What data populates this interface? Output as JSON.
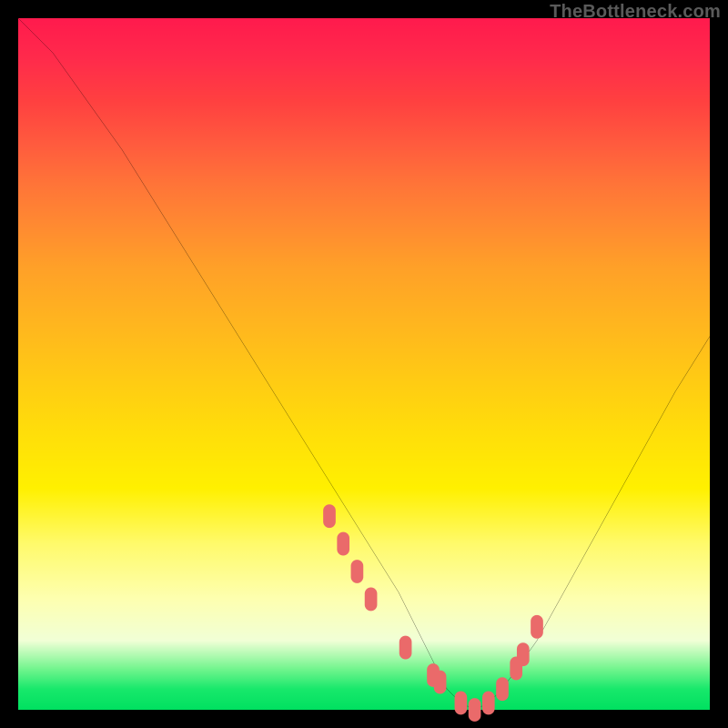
{
  "watermark": "TheBottleneck.com",
  "chart_data": {
    "type": "line",
    "title": "",
    "xlabel": "",
    "ylabel": "",
    "xlim": [
      0,
      100
    ],
    "ylim": [
      0,
      100
    ],
    "series": [
      {
        "name": "curve",
        "x": [
          0,
          5,
          10,
          15,
          20,
          25,
          30,
          35,
          40,
          45,
          50,
          55,
          58,
          60,
          62,
          64,
          66,
          68,
          70,
          75,
          80,
          85,
          90,
          95,
          100
        ],
        "y": [
          100,
          95,
          88,
          81,
          73,
          65,
          57,
          49,
          41,
          33,
          25,
          17,
          11,
          7,
          3,
          1,
          0,
          1,
          3,
          10,
          19,
          28,
          37,
          46,
          54
        ]
      }
    ],
    "markers": {
      "name": "bottleneck-dots",
      "color": "#ea6a6a",
      "x": [
        45,
        47,
        49,
        51,
        56,
        60,
        61,
        64,
        66,
        68,
        70,
        72,
        73,
        75
      ],
      "y": [
        28,
        24,
        20,
        16,
        9,
        5,
        4,
        1,
        0,
        1,
        3,
        6,
        8,
        12
      ]
    },
    "background_gradient": {
      "top": "#ff1a4d",
      "mid": "#ffde0a",
      "bottom": "#00e060"
    }
  }
}
